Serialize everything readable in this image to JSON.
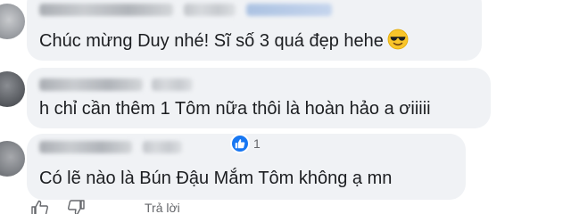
{
  "comments": [
    {
      "text": "Chúc mừng Duy nhé! Sĩ số 3 quá đẹp hehe",
      "emoji": "smiling-face-with-sunglasses"
    },
    {
      "text": "h chỉ cần thêm 1 Tôm nữa thôi là hoàn hảo a ơiiiii"
    },
    {
      "text": "Có lẽ nào là Bún Đậu Mắm Tôm không ạ mn",
      "reactions": {
        "type": "like",
        "count": "1"
      }
    }
  ],
  "actions": {
    "reply_label": "Trả lời"
  },
  "colors": {
    "bubble": "#f0f2f5",
    "like_blue": "#1877f2",
    "secondary_text": "#65676b"
  }
}
